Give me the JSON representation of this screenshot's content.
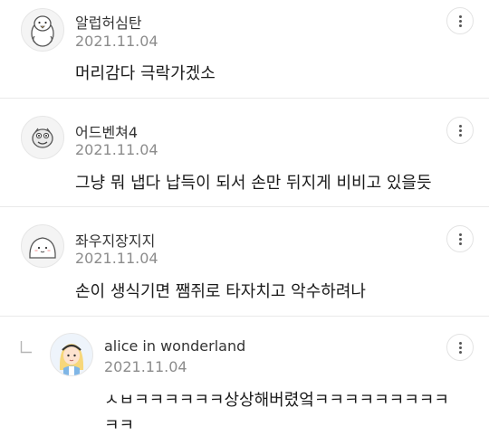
{
  "comments": [
    {
      "author": "알럽허심탄",
      "date": "2021.11.04",
      "text": "머리감다 극락가겠소",
      "avatar_icon": "penguin-avatar-icon"
    },
    {
      "author": "어드벤쳐4",
      "date": "2021.11.04",
      "text": "그냥 뭐 냅다 납득이 되서 손만 뒤지게 비비고 있을듯",
      "avatar_icon": "cartoon-face-avatar-icon"
    },
    {
      "author": "좌우지장지지",
      "date": "2021.11.04",
      "text": "손이 생식기면 쨈쥐로 타자치고 악수하려나",
      "avatar_icon": "blob-avatar-icon"
    },
    {
      "author": "alice in wonderland",
      "date": "2021.11.04",
      "text_line1": "ㅅㅂㅋㅋㅋㅋㅋㅋ상상해버렸엌ㅋㅋㅋㅋㅋㅋㅋㅋㅋ",
      "text_line2": "ㅋㅋ",
      "avatar_icon": "alice-avatar-icon",
      "is_reply": true
    }
  ],
  "more_icon": "more-vertical-icon",
  "reply_icon": "reply-indent-icon",
  "colors": {
    "date": "#8c8c8c",
    "divider": "#eaeaea",
    "text": "#1a1a1a"
  }
}
